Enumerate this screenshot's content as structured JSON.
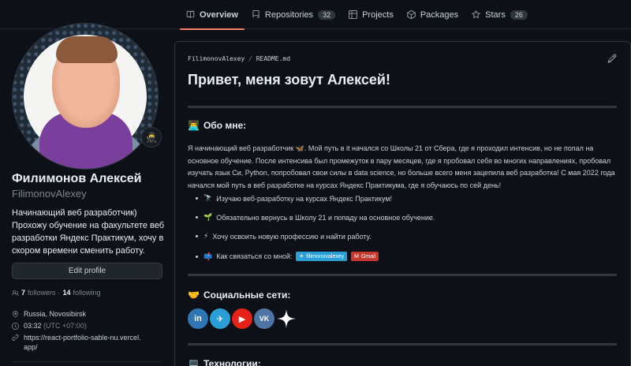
{
  "nav": {
    "tabs": [
      {
        "label": "Overview",
        "icon": "book-icon"
      },
      {
        "label": "Repositories",
        "icon": "repo-icon",
        "count": "32"
      },
      {
        "label": "Projects",
        "icon": "table-icon"
      },
      {
        "label": "Packages",
        "icon": "package-icon"
      },
      {
        "label": "Stars",
        "icon": "star-icon",
        "count": "26"
      }
    ]
  },
  "profile": {
    "status_emoji": "🥷",
    "fullname": "Филимонов Алексей",
    "username": "FilimonovAlexey",
    "bio": "Начинающий веб разработчик) Прохожу обучение на факультете веб разработки Яндекс Практикум, хочу в скором времени сменить работу.",
    "edit_label": "Edit profile",
    "followers": "7",
    "followers_label": "followers",
    "following": "14",
    "following_label": "following",
    "location": "Russia, Novosibirsk",
    "time": "03:32",
    "tz": "(UTC +07:00)",
    "website": "https://react-portfolio-sable-nu.vercel.app/"
  },
  "readme": {
    "owner": "FilimonovAlexey",
    "file": "README.md",
    "title": "Привет, меня зовут Алексей!",
    "about_heading": "Обо мне:",
    "about_emoji": "👨‍💻",
    "about_text": "Я начинающий веб разработчик 🦋. Мой путь в it начался со Школы 21 от Сбера, где я проходил интенсив, но не попал на основное обучение. После интенсива был промежуток в пару месяцев, где я пробовал себя во многих направлениях, пробовал изучать язык Си, Python, попробовал свои силы в data science, но больше всего меня зацепила веб разработка! С мая 2022 года начался мой путь в веб разработке на курсах Яндекс Практикума, где я обучаюсь по сей день!",
    "items": [
      {
        "emoji": "🔭",
        "text": "Изучаю веб-разработку на курсах Яндекс Практикум!"
      },
      {
        "emoji": "🌱",
        "text": "Обязательно вернусь в Школу 21 и попаду на основное обучение."
      },
      {
        "emoji": "⚡",
        "text": "Хочу освоить новую профессию и найти работу."
      },
      {
        "emoji": "📫",
        "text": "Как связаться со мной:"
      }
    ],
    "badge_telegram": "filimonovalexey",
    "badge_gmail": "Gmail",
    "social_heading": "Социальные сети:",
    "social_emoji": "🤝",
    "tech_heading": "Технологии:",
    "tech_emoji": "💻",
    "socials": [
      {
        "name": "linkedin",
        "label": "in",
        "color": "#2d75b4"
      },
      {
        "name": "telegram",
        "label": "✈",
        "color": "#2a9fd7"
      },
      {
        "name": "youtube",
        "label": "▶",
        "color": "#e62117"
      },
      {
        "name": "vk",
        "label": "VK",
        "color": "#4c75a3"
      }
    ]
  }
}
